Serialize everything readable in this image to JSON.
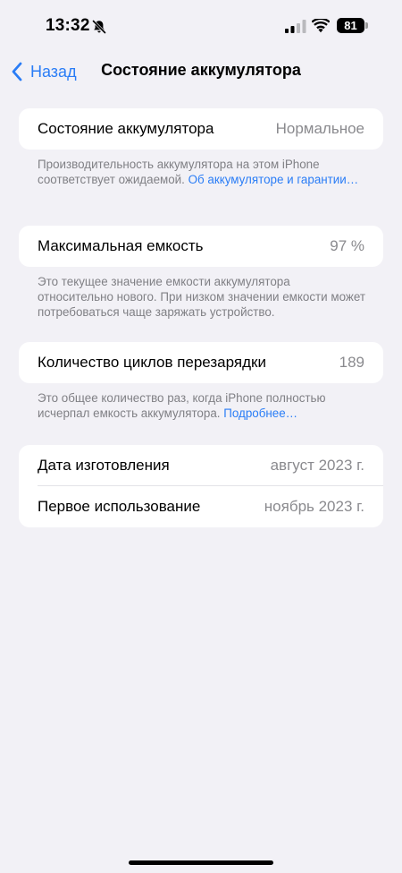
{
  "status_bar": {
    "time": "13:32",
    "battery_level": "81"
  },
  "nav": {
    "back_label": "Назад",
    "title": "Состояние аккумулятора"
  },
  "battery_health": {
    "label": "Состояние аккумулятора",
    "value": "Нормальное",
    "footnote_text": "Производительность аккумулятора на этом iPhone соответствует ожидаемой.",
    "footnote_link": "Об аккумуляторе и гарантии…"
  },
  "max_capacity": {
    "label": "Максимальная емкость",
    "value": "97 %",
    "footnote_text": "Это текущее значение емкости аккумулятора относительно нового. При низком значении емкости может потребоваться чаще заряжать устройство."
  },
  "cycle_count": {
    "label": "Количество циклов перезарядки",
    "value": "189",
    "footnote_text": "Это общее количество раз, когда iPhone полностью исчерпал емкость аккумулятора.",
    "footnote_link": "Подробнее…"
  },
  "dates": {
    "manufacture_label": "Дата изготовления",
    "manufacture_value": "август 2023 г.",
    "first_use_label": "Первое использование",
    "first_use_value": "ноябрь 2023 г."
  },
  "colors": {
    "accent": "#2a7df6",
    "background": "#f2f1f6",
    "secondary_text": "#8a8a8e"
  },
  "icons": {
    "silent": "bell-slash-icon",
    "signal": "cellular-signal-icon",
    "wifi": "wifi-icon",
    "back": "chevron-left-icon"
  }
}
